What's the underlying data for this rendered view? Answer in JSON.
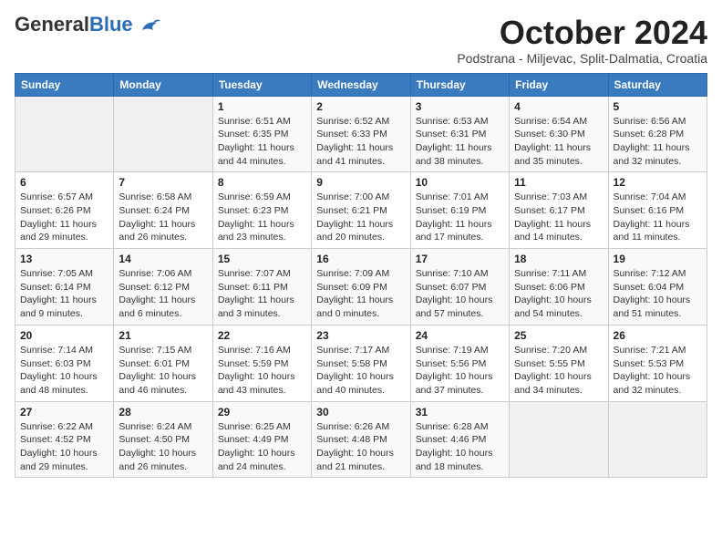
{
  "logo": {
    "general": "General",
    "blue": "Blue"
  },
  "title": "October 2024",
  "subtitle": "Podstrana - Miljevac, Split-Dalmatia, Croatia",
  "days_header": [
    "Sunday",
    "Monday",
    "Tuesday",
    "Wednesday",
    "Thursday",
    "Friday",
    "Saturday"
  ],
  "weeks": [
    [
      {
        "day": "",
        "content": ""
      },
      {
        "day": "",
        "content": ""
      },
      {
        "day": "1",
        "content": "Sunrise: 6:51 AM\nSunset: 6:35 PM\nDaylight: 11 hours and 44 minutes."
      },
      {
        "day": "2",
        "content": "Sunrise: 6:52 AM\nSunset: 6:33 PM\nDaylight: 11 hours and 41 minutes."
      },
      {
        "day": "3",
        "content": "Sunrise: 6:53 AM\nSunset: 6:31 PM\nDaylight: 11 hours and 38 minutes."
      },
      {
        "day": "4",
        "content": "Sunrise: 6:54 AM\nSunset: 6:30 PM\nDaylight: 11 hours and 35 minutes."
      },
      {
        "day": "5",
        "content": "Sunrise: 6:56 AM\nSunset: 6:28 PM\nDaylight: 11 hours and 32 minutes."
      }
    ],
    [
      {
        "day": "6",
        "content": "Sunrise: 6:57 AM\nSunset: 6:26 PM\nDaylight: 11 hours and 29 minutes."
      },
      {
        "day": "7",
        "content": "Sunrise: 6:58 AM\nSunset: 6:24 PM\nDaylight: 11 hours and 26 minutes."
      },
      {
        "day": "8",
        "content": "Sunrise: 6:59 AM\nSunset: 6:23 PM\nDaylight: 11 hours and 23 minutes."
      },
      {
        "day": "9",
        "content": "Sunrise: 7:00 AM\nSunset: 6:21 PM\nDaylight: 11 hours and 20 minutes."
      },
      {
        "day": "10",
        "content": "Sunrise: 7:01 AM\nSunset: 6:19 PM\nDaylight: 11 hours and 17 minutes."
      },
      {
        "day": "11",
        "content": "Sunrise: 7:03 AM\nSunset: 6:17 PM\nDaylight: 11 hours and 14 minutes."
      },
      {
        "day": "12",
        "content": "Sunrise: 7:04 AM\nSunset: 6:16 PM\nDaylight: 11 hours and 11 minutes."
      }
    ],
    [
      {
        "day": "13",
        "content": "Sunrise: 7:05 AM\nSunset: 6:14 PM\nDaylight: 11 hours and 9 minutes."
      },
      {
        "day": "14",
        "content": "Sunrise: 7:06 AM\nSunset: 6:12 PM\nDaylight: 11 hours and 6 minutes."
      },
      {
        "day": "15",
        "content": "Sunrise: 7:07 AM\nSunset: 6:11 PM\nDaylight: 11 hours and 3 minutes."
      },
      {
        "day": "16",
        "content": "Sunrise: 7:09 AM\nSunset: 6:09 PM\nDaylight: 11 hours and 0 minutes."
      },
      {
        "day": "17",
        "content": "Sunrise: 7:10 AM\nSunset: 6:07 PM\nDaylight: 10 hours and 57 minutes."
      },
      {
        "day": "18",
        "content": "Sunrise: 7:11 AM\nSunset: 6:06 PM\nDaylight: 10 hours and 54 minutes."
      },
      {
        "day": "19",
        "content": "Sunrise: 7:12 AM\nSunset: 6:04 PM\nDaylight: 10 hours and 51 minutes."
      }
    ],
    [
      {
        "day": "20",
        "content": "Sunrise: 7:14 AM\nSunset: 6:03 PM\nDaylight: 10 hours and 48 minutes."
      },
      {
        "day": "21",
        "content": "Sunrise: 7:15 AM\nSunset: 6:01 PM\nDaylight: 10 hours and 46 minutes."
      },
      {
        "day": "22",
        "content": "Sunrise: 7:16 AM\nSunset: 5:59 PM\nDaylight: 10 hours and 43 minutes."
      },
      {
        "day": "23",
        "content": "Sunrise: 7:17 AM\nSunset: 5:58 PM\nDaylight: 10 hours and 40 minutes."
      },
      {
        "day": "24",
        "content": "Sunrise: 7:19 AM\nSunset: 5:56 PM\nDaylight: 10 hours and 37 minutes."
      },
      {
        "day": "25",
        "content": "Sunrise: 7:20 AM\nSunset: 5:55 PM\nDaylight: 10 hours and 34 minutes."
      },
      {
        "day": "26",
        "content": "Sunrise: 7:21 AM\nSunset: 5:53 PM\nDaylight: 10 hours and 32 minutes."
      }
    ],
    [
      {
        "day": "27",
        "content": "Sunrise: 6:22 AM\nSunset: 4:52 PM\nDaylight: 10 hours and 29 minutes."
      },
      {
        "day": "28",
        "content": "Sunrise: 6:24 AM\nSunset: 4:50 PM\nDaylight: 10 hours and 26 minutes."
      },
      {
        "day": "29",
        "content": "Sunrise: 6:25 AM\nSunset: 4:49 PM\nDaylight: 10 hours and 24 minutes."
      },
      {
        "day": "30",
        "content": "Sunrise: 6:26 AM\nSunset: 4:48 PM\nDaylight: 10 hours and 21 minutes."
      },
      {
        "day": "31",
        "content": "Sunrise: 6:28 AM\nSunset: 4:46 PM\nDaylight: 10 hours and 18 minutes."
      },
      {
        "day": "",
        "content": ""
      },
      {
        "day": "",
        "content": ""
      }
    ]
  ]
}
